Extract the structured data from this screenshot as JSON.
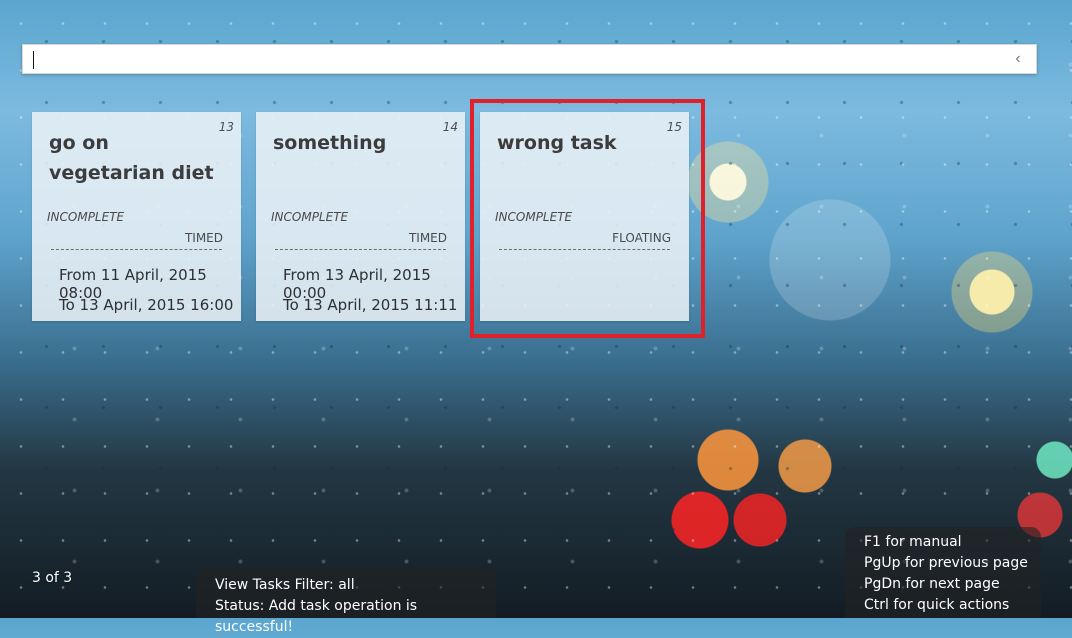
{
  "command_bar": {
    "value": "",
    "placeholder": "",
    "collapse_icon": "chevron-left-icon"
  },
  "cards": [
    {
      "number": "13",
      "title": "go on vegetarian diet",
      "status": "INCOMPLETE",
      "type": "TIMED",
      "from": "From 11 April, 2015 08:00",
      "to": "To 13 April, 2015 16:00"
    },
    {
      "number": "14",
      "title": "something",
      "status": "INCOMPLETE",
      "type": "TIMED",
      "from": "From 13 April, 2015 00:00",
      "to": "To 13 April, 2015 11:11"
    },
    {
      "number": "15",
      "title": "wrong task",
      "status": "INCOMPLETE",
      "type": "FLOATING",
      "from": "",
      "to": ""
    }
  ],
  "page_counter": "3 of 3",
  "status_panel": {
    "filter_text": "View Tasks Filter: all",
    "status_text": "Status: Add task operation is successful!"
  },
  "help_panel": [
    "F1 for manual",
    "PgUp for previous page",
    "PgDn for next page",
    "Ctrl for quick actions"
  ],
  "colors": {
    "selection": "#e0212b",
    "card_bg": "#ecf2f7",
    "panel_bg": "#232323"
  }
}
